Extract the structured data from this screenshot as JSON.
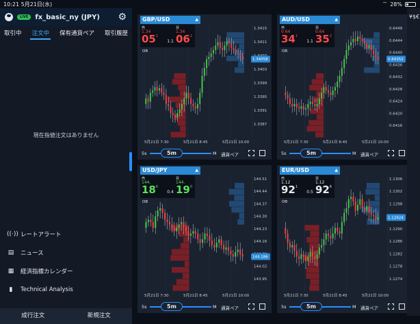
{
  "status_bar": {
    "time": "10:21",
    "date": "5月21日(水)",
    "battery": "28%",
    "battery_level": 0.28
  },
  "account": {
    "live_badge": "LIVE",
    "name": "fx_basic_ny (JPY)"
  },
  "tabs": [
    {
      "label": "取引中",
      "active": false
    },
    {
      "label": "注文中",
      "active": true
    },
    {
      "label": "保有通貨ペア",
      "active": false
    },
    {
      "label": "取引履歴",
      "active": false
    }
  ],
  "empty_message": "現在指値注文はありません",
  "menu": [
    {
      "label": "レートアラート",
      "icon": "signal-icon"
    },
    {
      "label": "ニュース",
      "icon": "news-icon"
    },
    {
      "label": "経済指標カレンダー",
      "icon": "calendar-icon"
    },
    {
      "label": "Technical Analysis",
      "icon": "chart-icon"
    }
  ],
  "bottom_bar": {
    "left": "成行注文",
    "right": "新規注文"
  },
  "side_label": "¥$€",
  "charts": [
    {
      "pair": "GBP/USD",
      "bid_label": "売",
      "ask_label": "買",
      "bid_pre": "1.34",
      "bid_big": "05",
      "bid_pip": "1",
      "ask_pre": "1.34",
      "ask_big": "06",
      "ask_pip": "2",
      "spread": "1.1",
      "bid_color": "red",
      "ask_color": "red",
      "ob": "OB",
      "y_ticks": [
        "1.3415",
        "1.3411",
        "1.3407",
        "1.3403",
        "1.3399",
        "1.3395",
        "1.3391",
        "1.3387"
      ],
      "current": "1.34058",
      "x_ticks": [
        "5月21日 7:30",
        "5月21日 8:45",
        "5月21日 10:00"
      ],
      "toolbar": {
        "s5": "5s",
        "tf": "5m",
        "m": "M",
        "pair_label": "通貨ペア"
      }
    },
    {
      "pair": "AUD/USD",
      "bid_label": "売",
      "ask_label": "買",
      "bid_pre": "0.64",
      "bid_big": "34",
      "bid_pip": "1",
      "ask_pre": "0.64",
      "ask_big": "35",
      "ask_pip": "2",
      "spread": "1.1",
      "bid_color": "red",
      "ask_color": "red",
      "ob": "OB",
      "y_ticks": [
        "0.6448",
        "0.6444",
        "0.6440",
        "0.6436",
        "0.6432",
        "0.6428",
        "0.6424",
        "0.6420",
        "0.6416"
      ],
      "current": "0.64352",
      "x_ticks": [
        "5月21日 7:30",
        "5月21日 8:45",
        "5月21日 10:00"
      ],
      "toolbar": {
        "s5": "5s",
        "tf": "5m",
        "m": "M",
        "pair_label": "通貨ペア"
      }
    },
    {
      "pair": "USD/JPY",
      "bid_label": "売",
      "ask_label": "買",
      "bid_pre": "144.",
      "bid_big": "18",
      "bid_pip": "6",
      "ask_pre": "144.",
      "ask_big": "19",
      "ask_pip": "0",
      "spread": "0.4",
      "bid_color": "green",
      "ask_color": "green",
      "ob": "OB",
      "y_ticks": [
        "144.51",
        "144.44",
        "144.37",
        "144.30",
        "144.23",
        "144.16",
        "144.09",
        "144.02",
        "143.95"
      ],
      "current": "144.186",
      "x_ticks": [
        "5月21日 7:30",
        "5月21日 8:45",
        "5月21日 10:00"
      ],
      "toolbar": {
        "s5": "5s",
        "tf": "5m",
        "m": "M",
        "pair_label": "通貨ペア"
      }
    },
    {
      "pair": "EUR/USD",
      "bid_label": "売",
      "ask_label": "買",
      "bid_pre": "1.12",
      "bid_big": "92",
      "bid_pip": "1",
      "ask_pre": "1.12",
      "ask_big": "92",
      "ask_pip": "6",
      "spread": "0.5",
      "bid_color": "white",
      "ask_color": "white",
      "ob": "OB",
      "y_ticks": [
        "1.1306",
        "1.1302",
        "1.1298",
        "1.1294",
        "1.1290",
        "1.1286",
        "1.1282",
        "1.1278",
        "1.1274"
      ],
      "current": "1.12924",
      "x_ticks": [
        "5月21日 7:30",
        "5月21日 8:45",
        "5月21日 10:00"
      ],
      "toolbar": {
        "s5": "5s",
        "tf": "5m",
        "m": "M",
        "pair_label": "通貨ペア"
      }
    }
  ],
  "colors": {
    "accent": "#2a8fff",
    "up": "#3ccf3c",
    "down": "#ff3b3b",
    "panel": "#1a2230",
    "orderbook_red": "#b4262a",
    "orderbook_blue": "#2a5a8a"
  }
}
